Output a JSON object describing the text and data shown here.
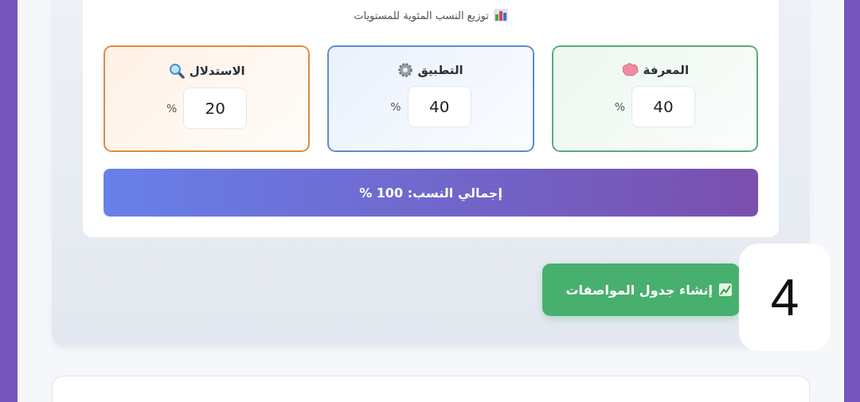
{
  "header": {
    "title": "توزيع النسب المئوية للمستويات"
  },
  "levels": [
    {
      "kind": "knowledge",
      "label": "المعرفة",
      "value": "40",
      "unit": "%",
      "color": "#5aaa7c"
    },
    {
      "kind": "application",
      "label": "التطبيق",
      "value": "40",
      "unit": "%",
      "color": "#5b8fc7"
    },
    {
      "kind": "reasoning",
      "label": "الاستدلال",
      "value": "20",
      "unit": "%",
      "color": "#e08a3c"
    }
  ],
  "total": {
    "text": "إجمالي النسب: 100 %"
  },
  "action_button": {
    "label": "إنشاء جدول المواصفات"
  },
  "badge": {
    "text": "4"
  }
}
